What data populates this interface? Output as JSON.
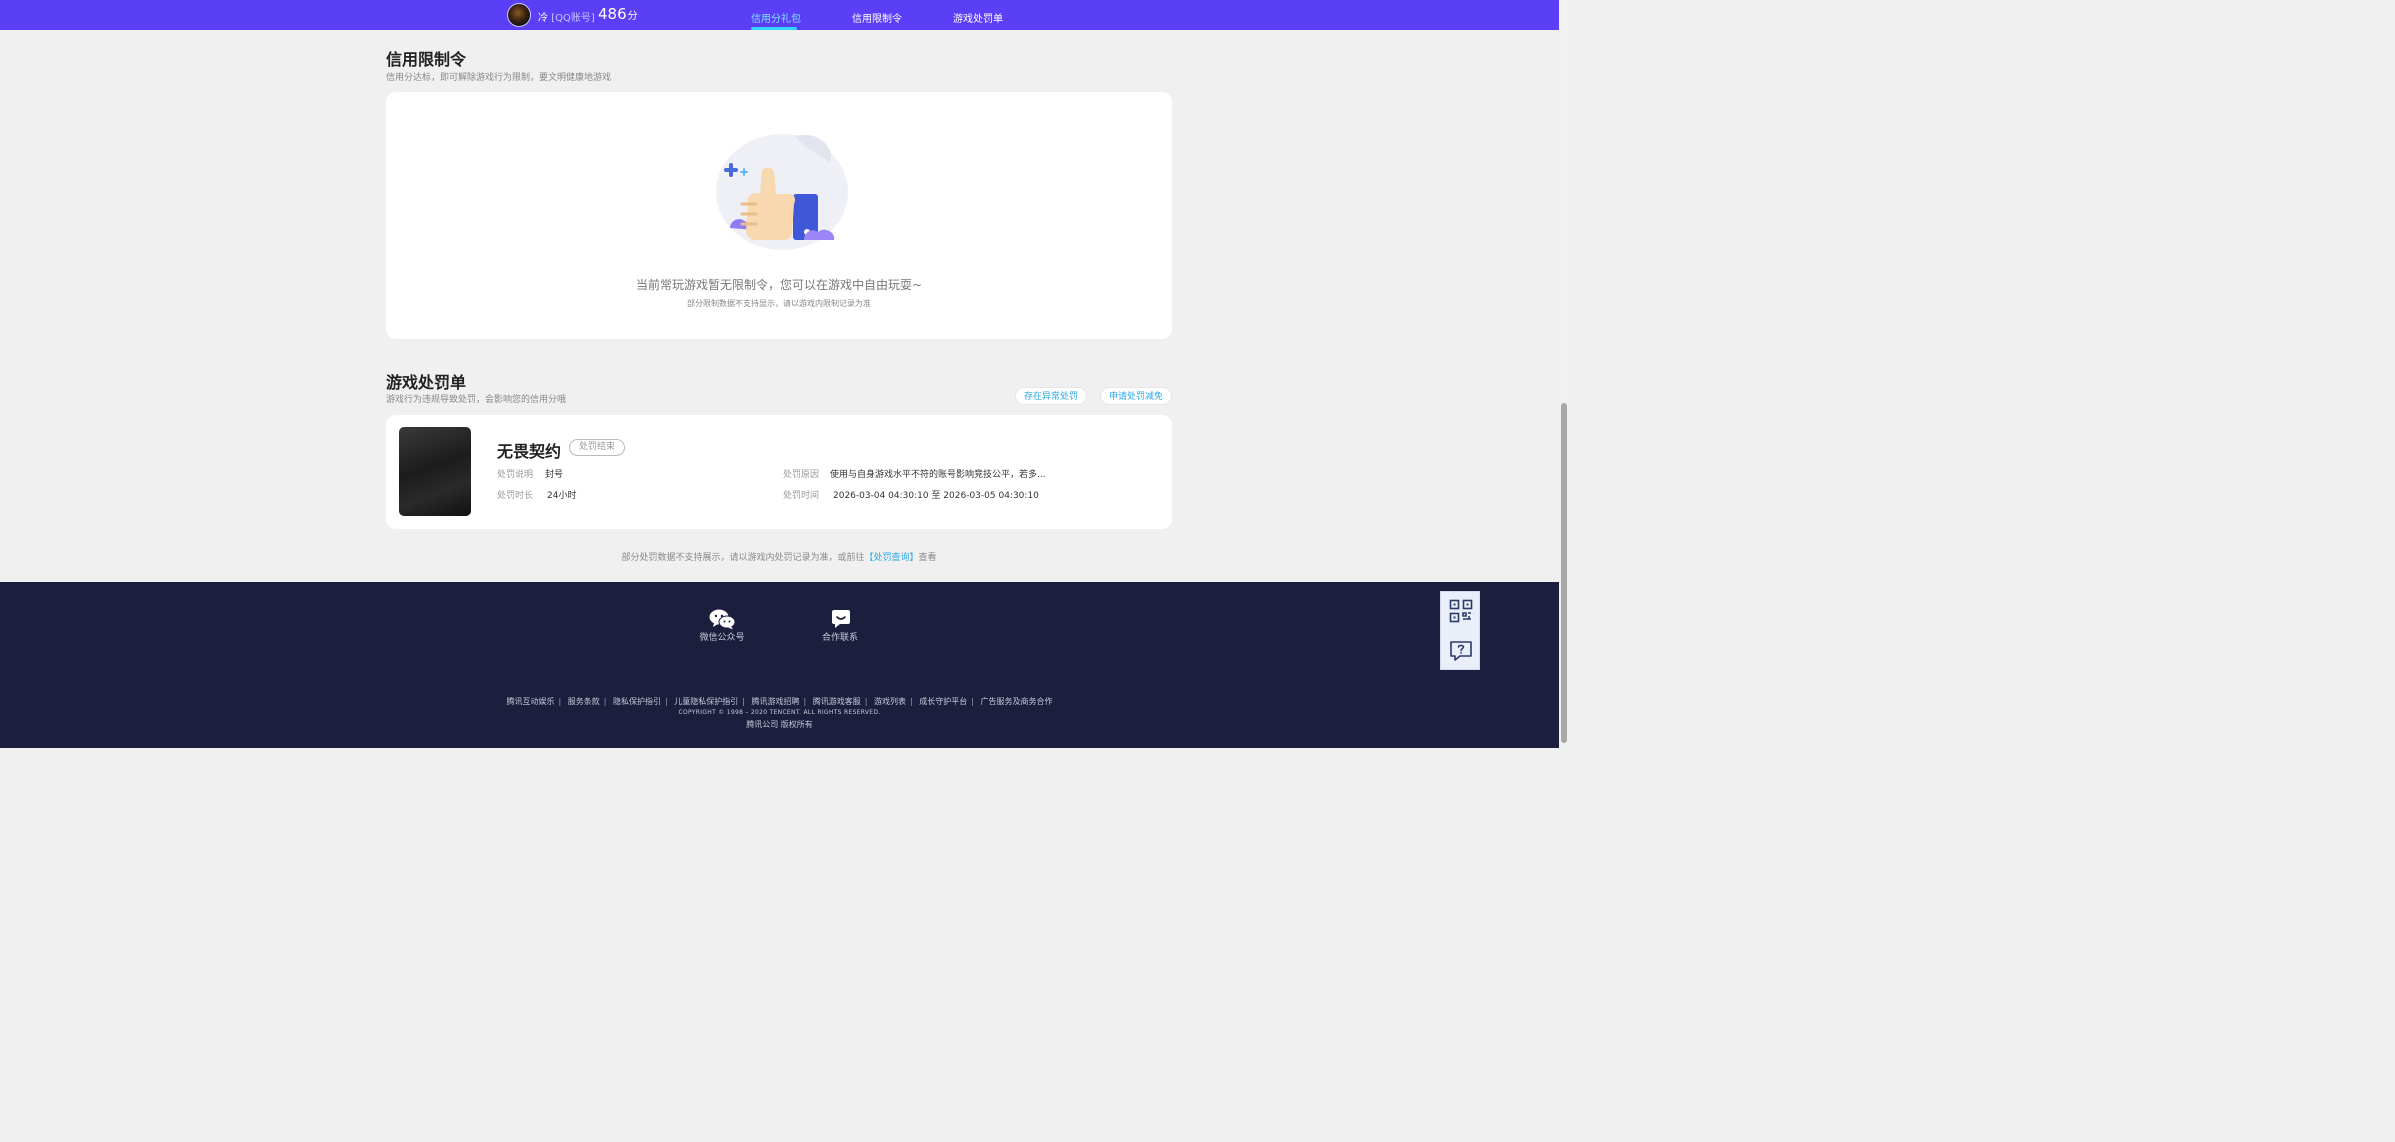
{
  "header": {
    "username": "冷",
    "account_type": "[QQ账号]",
    "score": "486",
    "score_unit": "分",
    "nav": [
      {
        "label": "信用分礼包",
        "active": true
      },
      {
        "label": "信用限制令",
        "active": false
      },
      {
        "label": "游戏处罚单",
        "active": false
      }
    ]
  },
  "restriction": {
    "title": "信用限制令",
    "subtitle": "信用分达标，即可解除游戏行为限制，要文明健康地游戏",
    "empty_message": "当前常玩游戏暂无限制令，您可以在游戏中自由玩耍~",
    "empty_note": "部分限制数据不支持显示，请以游戏内限制记录为准"
  },
  "penalty": {
    "title": "游戏处罚单",
    "subtitle": "游戏行为违规导致处罚，会影响您的信用分哦",
    "btn_abnormal": "存在异常处罚",
    "btn_reduce": "申请处罚减免",
    "item": {
      "game_name": "无畏契约",
      "status": "处罚结束",
      "desc_label": "处罚说明",
      "desc_value": "封号",
      "duration_label": "处罚时长",
      "duration_value": "24小时",
      "reason_label": "处罚原因",
      "reason_value": "使用与自身游戏水平不符的账号影响竞技公平，若多...",
      "time_label": "处罚时间",
      "time_value": "2026-03-04 04:30:10 至 2026-03-05 04:30:10"
    },
    "note_prefix": "部分处罚数据不支持展示，请以游戏内处罚记录为准，或前往",
    "note_link": "【处罚查询】",
    "note_suffix": "查看"
  },
  "footer": {
    "wechat_label": "微信公众号",
    "contact_label": "合作联系",
    "links": [
      "腾讯互动娱乐",
      "服务条款",
      "隐私保护指引",
      "儿童隐私保护指引",
      "腾讯游戏招聘",
      "腾讯游戏客服",
      "游戏列表",
      "成长守护平台",
      "广告服务及商务合作"
    ],
    "copyright": "COPYRIGHT © 1998 – 2020 TENCENT. ALL RIGHTS RESERVED.",
    "rights": "腾讯公司 版权所有"
  },
  "colors": {
    "topbar": "#5b3ff6",
    "accent_link": "#29a9e8",
    "footer_bg": "#1c1e3e"
  },
  "icons": [
    "qr-code-icon",
    "feedback-icon",
    "wechat-icon",
    "chat-icon",
    "thumbs-up-illustration"
  ]
}
